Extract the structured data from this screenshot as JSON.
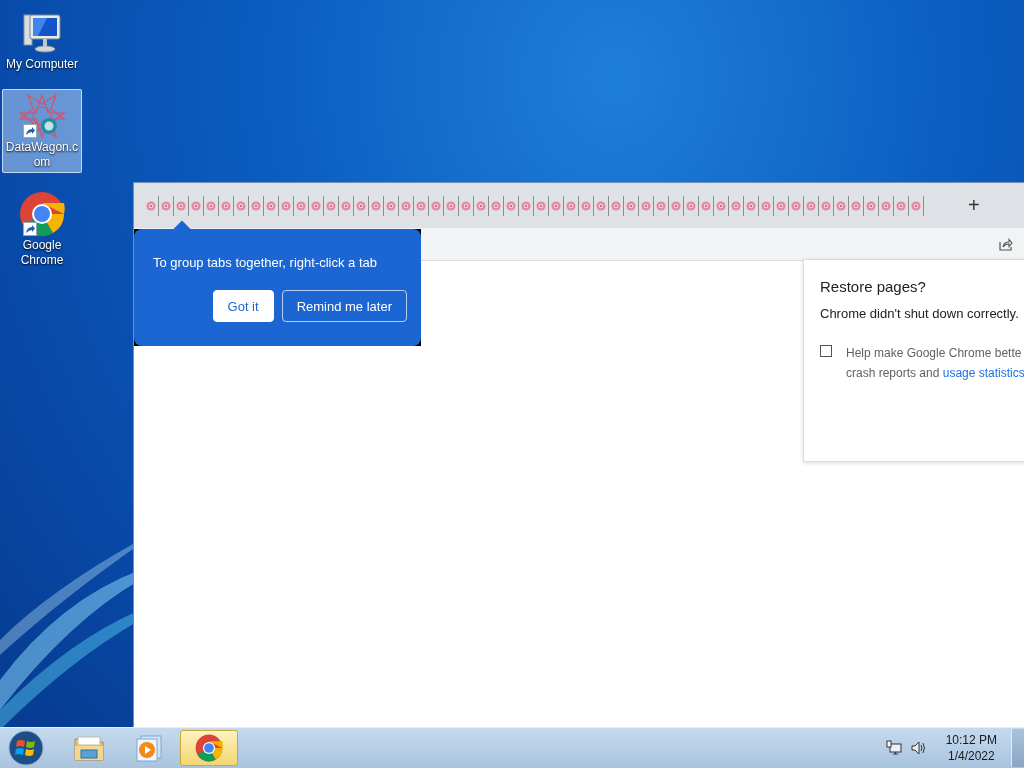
{
  "desktop_icons": [
    {
      "label": "My Computer",
      "kind": "computer",
      "selected": false,
      "shortcut": false
    },
    {
      "label": "DataWagon.com",
      "kind": "datawagon",
      "selected": true,
      "shortcut": true
    },
    {
      "label": "Google Chrome",
      "kind": "chrome",
      "selected": false,
      "shortcut": true
    }
  ],
  "browser": {
    "tabs": [
      {
        "selected": false
      },
      {
        "selected": false
      },
      {
        "selected": false
      },
      {
        "selected": false
      },
      {
        "selected": false
      },
      {
        "selected": false
      },
      {
        "selected": false
      },
      {
        "selected": false
      },
      {
        "selected": false
      },
      {
        "selected": false
      },
      {
        "selected": false
      },
      {
        "selected": false
      },
      {
        "selected": false
      },
      {
        "selected": false
      },
      {
        "selected": false
      },
      {
        "selected": false
      },
      {
        "selected": false
      },
      {
        "selected": false
      },
      {
        "selected": false
      },
      {
        "selected": false
      },
      {
        "selected": false
      },
      {
        "selected": false
      },
      {
        "selected": false
      },
      {
        "selected": false
      },
      {
        "selected": false
      },
      {
        "selected": false
      },
      {
        "selected": false
      },
      {
        "selected": false
      },
      {
        "selected": false
      },
      {
        "selected": false
      },
      {
        "selected": false
      },
      {
        "selected": false
      },
      {
        "selected": false
      },
      {
        "selected": false
      },
      {
        "selected": false
      },
      {
        "selected": false
      },
      {
        "selected": false
      },
      {
        "selected": false
      },
      {
        "selected": false
      },
      {
        "selected": false
      },
      {
        "selected": false
      },
      {
        "selected": false
      },
      {
        "selected": false
      },
      {
        "selected": false
      },
      {
        "selected": false
      },
      {
        "selected": false
      },
      {
        "selected": false
      },
      {
        "selected": false
      },
      {
        "selected": false
      },
      {
        "selected": false
      },
      {
        "selected": false
      },
      {
        "selected": false
      }
    ],
    "new_tab_button": "+",
    "tip_bubble": {
      "text": "To group tabs together, right-click a tab",
      "buttons": [
        {
          "label": "Got it",
          "kind": "primary"
        },
        {
          "label": "Remind me later",
          "kind": "secondary"
        }
      ]
    },
    "restore_dialog": {
      "title": "Restore pages?",
      "message": "Chrome didn't shut down correctly.",
      "consent": {
        "checked": false,
        "line_1": "Help make Google Chrome bette",
        "line_2": "crash reports and ",
        "link": "usage statistics"
      }
    }
  },
  "taskbar": {
    "items": [
      {
        "kind": "explorer",
        "selected": false
      },
      {
        "kind": "media",
        "selected": false
      },
      {
        "kind": "chrome",
        "selected": true
      }
    ],
    "clock": {
      "time": "10:12 PM",
      "date": "1/4/2022"
    }
  }
}
